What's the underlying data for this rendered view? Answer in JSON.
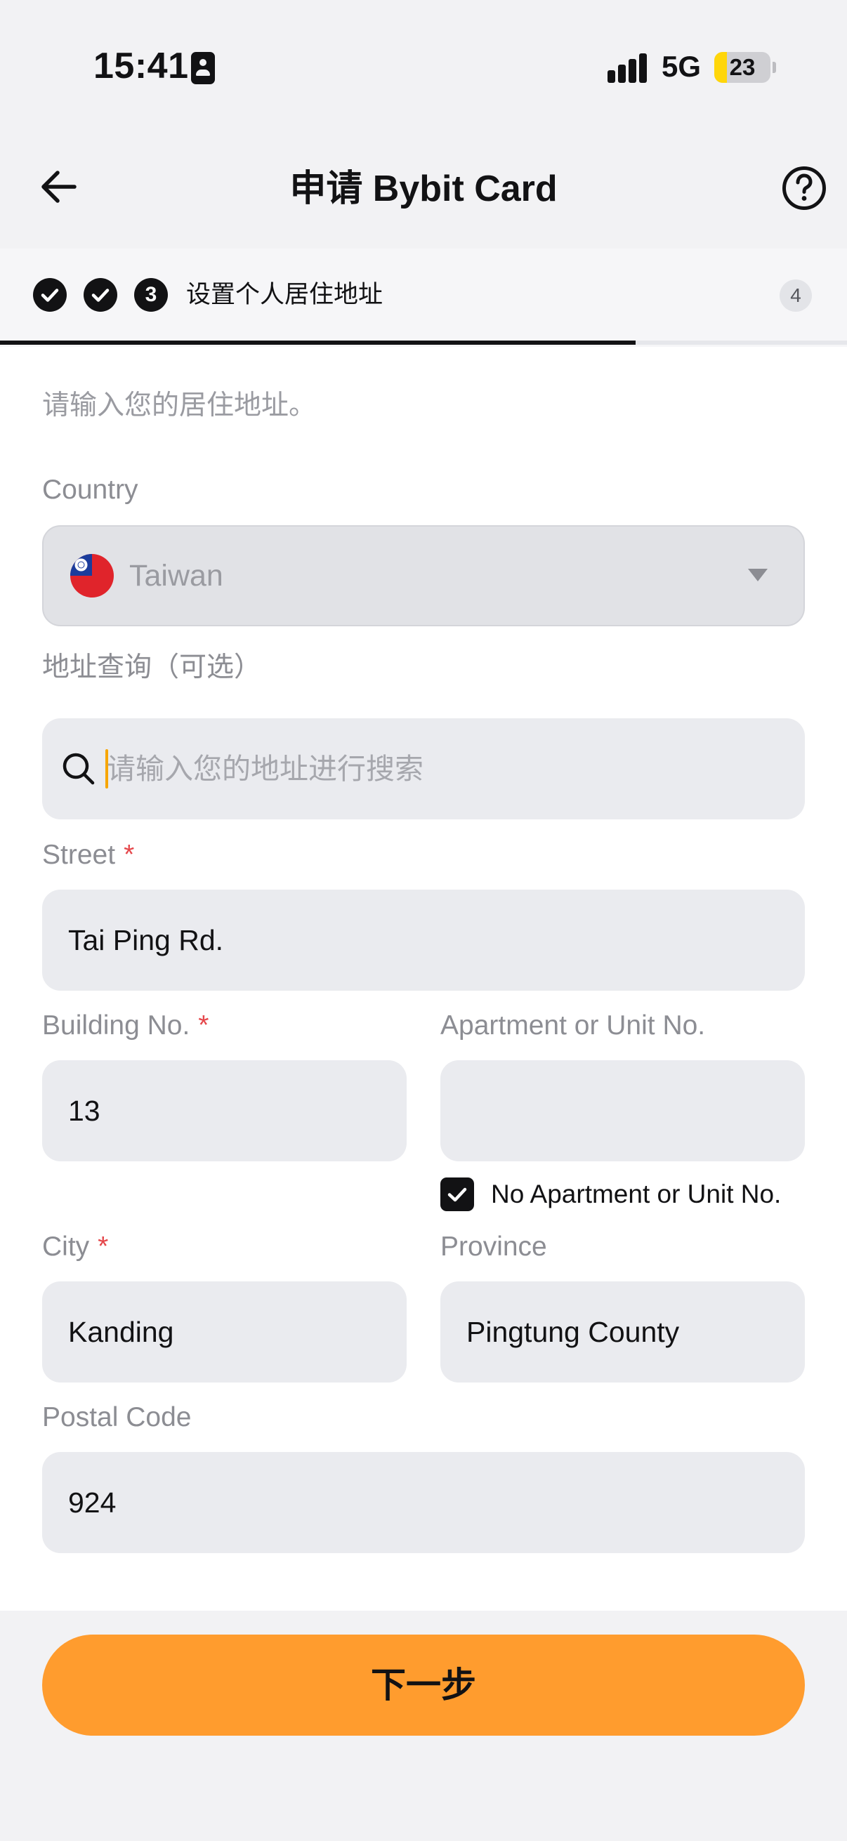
{
  "status_bar": {
    "time": "15:41",
    "network": "5G",
    "battery_level": "23",
    "battery_fraction": 0.23,
    "battery_color": "#ffd60a"
  },
  "header": {
    "title": "申请 Bybit Card",
    "back_icon": "arrow-left-icon",
    "help_icon": "question-circle-icon"
  },
  "steps": {
    "current_number": "3",
    "current_label": "设置个人居住地址",
    "total": "4",
    "progress_fraction": 0.75
  },
  "form": {
    "intro": "请输入您的居住地址。",
    "country": {
      "label": "Country",
      "value": "Taiwan",
      "flag_icon": "taiwan-flag-icon"
    },
    "address_lookup": {
      "label": "地址查询（可选）",
      "placeholder": "请输入您的地址进行搜索"
    },
    "street": {
      "label": "Street",
      "required": "*",
      "value": "Tai Ping Rd."
    },
    "building": {
      "label": "Building No.",
      "required": "*",
      "value": "13"
    },
    "apartment": {
      "label": "Apartment or Unit No.",
      "value": ""
    },
    "no_apartment": {
      "label": "No Apartment or Unit No.",
      "checked": true
    },
    "city": {
      "label": "City",
      "required": "*",
      "value": "Kanding"
    },
    "province": {
      "label": "Province",
      "value": "Pingtung County"
    },
    "postal_code": {
      "label": "Postal Code",
      "value": "924"
    }
  },
  "footer": {
    "next_label": "下一步",
    "accent_color": "#ff9c2e"
  }
}
